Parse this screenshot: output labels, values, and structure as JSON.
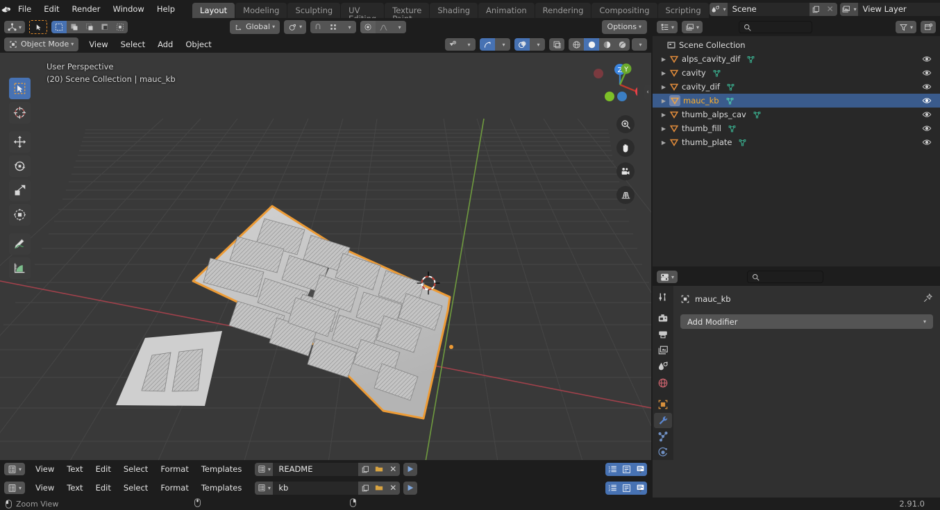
{
  "app": {
    "name": "Blender",
    "version": "2.91.0"
  },
  "topbar": {
    "menus": [
      "File",
      "Edit",
      "Render",
      "Window",
      "Help"
    ],
    "workspace_tabs": [
      {
        "label": "Layout",
        "active": true
      },
      {
        "label": "Modeling",
        "active": false
      },
      {
        "label": "Sculpting",
        "active": false
      },
      {
        "label": "UV Editing",
        "active": false
      },
      {
        "label": "Texture Paint",
        "active": false
      },
      {
        "label": "Shading",
        "active": false
      },
      {
        "label": "Animation",
        "active": false
      },
      {
        "label": "Rendering",
        "active": false
      },
      {
        "label": "Compositing",
        "active": false
      },
      {
        "label": "Scripting",
        "active": false
      }
    ],
    "scene_field": {
      "label": "Scene",
      "icon": "scene-icon"
    },
    "view_layer_field": {
      "label": "View Layer",
      "icon": "view-layer-icon"
    }
  },
  "viewport": {
    "header": {
      "mode": "Object Mode",
      "menus": [
        "View",
        "Select",
        "Add",
        "Object"
      ],
      "transform_orientation": "Global",
      "options_label": "Options"
    },
    "overlay": {
      "perspective": "User Perspective",
      "scene_info": "(20) Scene Collection | mauc_kb"
    },
    "tools": [
      {
        "name": "tweak-select-tool",
        "active": true
      },
      {
        "name": "cursor-tool",
        "active": false
      },
      {
        "name": "move-tool",
        "active": false
      },
      {
        "name": "rotate-tool",
        "active": false
      },
      {
        "name": "scale-tool",
        "active": false
      },
      {
        "name": "transform-tool",
        "active": false
      },
      {
        "name": "annotate-tool",
        "active": false
      },
      {
        "name": "measure-tool",
        "active": false
      }
    ],
    "gizmo_axes": [
      "Z",
      "Y",
      "X"
    ],
    "nav_buttons": [
      "zoom-icon",
      "pan-hand-icon",
      "camera-icon",
      "ortho-grid-icon"
    ],
    "shading_modes": [
      "wireframe",
      "solid",
      "material-preview",
      "rendered"
    ],
    "active_shading_mode": "solid",
    "colors": {
      "background": "#393939",
      "grid_line": "#474747",
      "axis_x": "#a6434c",
      "axis_y": "#6f9b3f",
      "select_outline": "#ed9b35",
      "object_surface": "#c8c8c8"
    }
  },
  "outliner": {
    "search_placeholder": "",
    "root": "Scene Collection",
    "items": [
      {
        "label": "alps_cavity_dif",
        "selected": false,
        "visible": true
      },
      {
        "label": "cavity",
        "selected": false,
        "visible": true
      },
      {
        "label": "cavity_dif",
        "selected": false,
        "visible": true
      },
      {
        "label": "mauc_kb",
        "selected": true,
        "visible": true
      },
      {
        "label": "thumb_alps_cav",
        "selected": false,
        "visible": true
      },
      {
        "label": "thumb_fill",
        "selected": false,
        "visible": true
      },
      {
        "label": "thumb_plate",
        "selected": false,
        "visible": true
      }
    ]
  },
  "properties": {
    "search_placeholder": "",
    "object_name": "mauc_kb",
    "add_modifier_label": "Add Modifier",
    "tabs": [
      {
        "name": "tool-tab",
        "active": false
      },
      {
        "name": "render-tab",
        "active": false
      },
      {
        "name": "output-tab",
        "active": false
      },
      {
        "name": "view-layer-tab",
        "active": false
      },
      {
        "name": "scene-tab",
        "active": false
      },
      {
        "name": "world-tab",
        "active": false
      },
      {
        "name": "object-tab",
        "active": false
      },
      {
        "name": "modifier-tab",
        "active": true
      },
      {
        "name": "particles-tab",
        "active": false
      },
      {
        "name": "physics-tab",
        "active": false
      }
    ]
  },
  "text_editors": [
    {
      "menus": [
        "View",
        "Text",
        "Edit",
        "Select",
        "Format",
        "Templates"
      ],
      "datablock_name": "README"
    },
    {
      "menus": [
        "View",
        "Text",
        "Edit",
        "Select",
        "Format",
        "Templates"
      ],
      "datablock_name": "kb"
    }
  ],
  "statusbar": {
    "hint_label": "Zoom View",
    "version": "2.91.0"
  }
}
